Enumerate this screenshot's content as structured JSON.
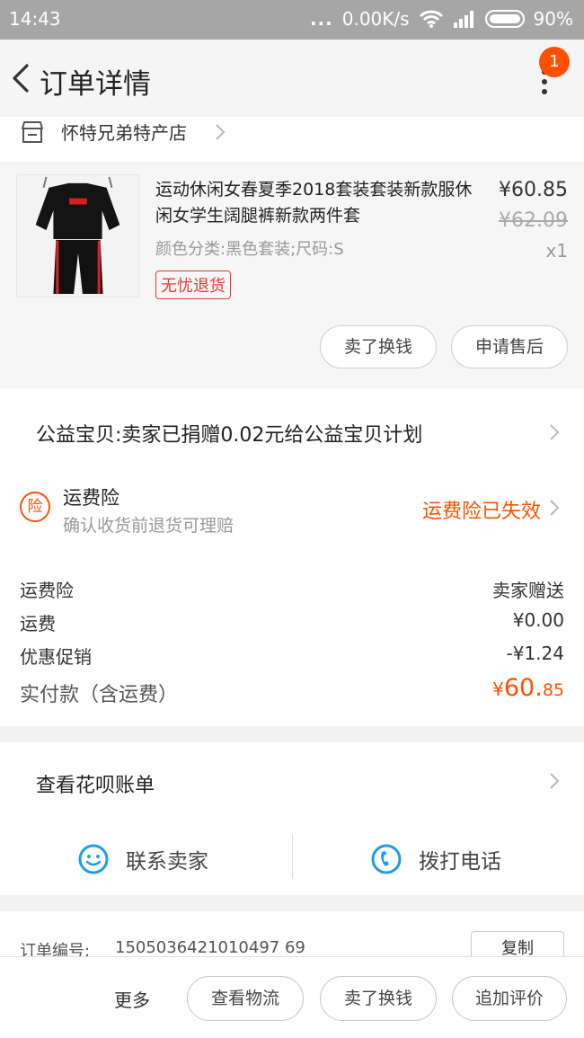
{
  "status_bar": {
    "time": "14:43",
    "dots": "...",
    "network_speed": "0.00K/s",
    "battery": "90%"
  },
  "header": {
    "title": "订单详情",
    "notification_count": "1"
  },
  "shop": {
    "name": "怀特兄弟特产店"
  },
  "product": {
    "title": "运动休闲女春夏季2018套装套装新款服休闲女学生阔腿裤新款两件套",
    "sku": "颜色分类:黑色套装;尺码:S",
    "tag": "无忧退货",
    "price": "¥60.85",
    "original_price": "¥62.09",
    "quantity": "x1",
    "actions": [
      "卖了换钱",
      "申请售后"
    ]
  },
  "charity": {
    "text": "公益宝贝:卖家已捐赠0.02元给公益宝贝计划"
  },
  "insurance": {
    "icon_text": "险",
    "title": "运费险",
    "subtitle": "确认收货前退货可理赔",
    "status": "运费险已失效"
  },
  "fees": {
    "rows": [
      {
        "label": "运费险",
        "value": "卖家赠送"
      },
      {
        "label": "运费",
        "value": "¥0.00"
      },
      {
        "label": "优惠促销",
        "value": "-¥1.24"
      }
    ],
    "total_label": "实付款（含运费）",
    "total_currency": "¥",
    "total_int": "60.",
    "total_dec": "85"
  },
  "huabei": {
    "label": "查看花呗账单"
  },
  "contact": {
    "seller": "联系卖家",
    "phone": "拨打电话"
  },
  "order": {
    "label": "订单编号:",
    "number": "1505036421010497 69",
    "copy": "复制"
  },
  "bottom_bar": {
    "more": "更多",
    "buttons": [
      "查看物流",
      "卖了换钱",
      "追加评价"
    ]
  },
  "colors": {
    "accent": "#ff5000",
    "tag_red": "#e4393c",
    "contact_blue": "#1e9de8"
  },
  "icons": [
    "back-arrow-icon",
    "more-vertical-icon",
    "shop-icon",
    "chevron-right-icon",
    "insurance-icon",
    "smiley-chat-icon",
    "phone-icon"
  ]
}
